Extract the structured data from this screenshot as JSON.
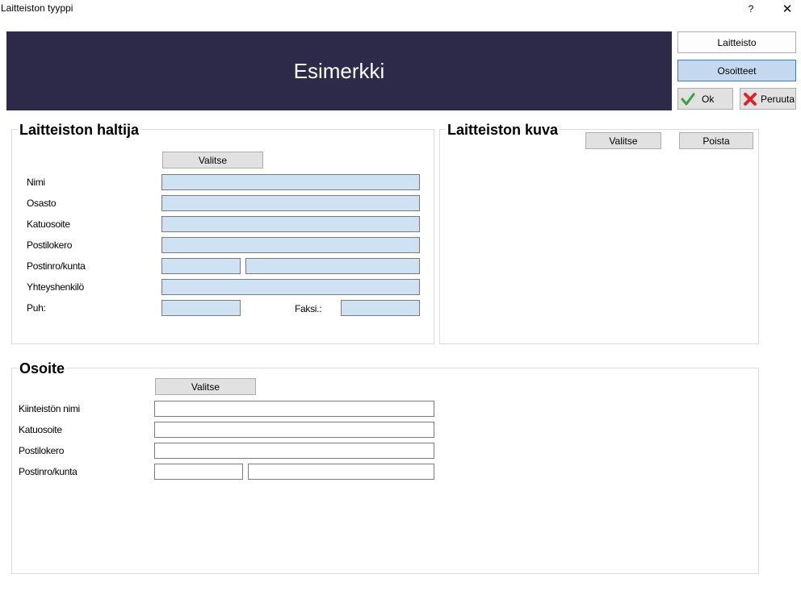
{
  "window": {
    "title": "Laitteiston tyyppi",
    "help_label": "?",
    "close_label": "✕"
  },
  "banner": {
    "text": "Esimerkki"
  },
  "side_buttons": {
    "laitteisto": "Laitteisto",
    "osoitteet": "Osoitteet",
    "ok": "Ok",
    "peruuta": "Peruuta"
  },
  "holder": {
    "title": "Laitteiston haltija",
    "select_label": "Valitse",
    "labels": {
      "nimi": "Nimi",
      "osasto": "Osasto",
      "katuosoite": "Katuosoite",
      "postilokero": "Postilokero",
      "postinro_kunta": "Postinro/kunta",
      "yhteyshenkilo": "Yhteyshenkilö",
      "puh": "Puh:",
      "faksi": "Faksi.:"
    },
    "values": {
      "nimi": "",
      "osasto": "",
      "katuosoite": "",
      "postilokero": "",
      "postinro": "",
      "kunta": "",
      "yhteyshenkilo": "",
      "puh": "",
      "faksi": ""
    }
  },
  "picture": {
    "title": "Laitteiston kuva",
    "select_label": "Valitse",
    "remove_label": "Poista"
  },
  "address": {
    "title": "Osoite",
    "select_label": "Valitse",
    "labels": {
      "kiinteisto": "Kiinteistön nimi",
      "katuosoite": "Katuosoite",
      "postilokero": "Postilokero",
      "postinro_kunta": "Postinro/kunta"
    },
    "values": {
      "kiinteisto": "",
      "katuosoite": "",
      "postilokero": "",
      "postinro": "",
      "kunta": ""
    }
  },
  "colors": {
    "banner_bg": "#2c2a48",
    "field_blue": "#cfe2f3",
    "active_button": "#c4d9f0",
    "ok_green": "#3aa33a",
    "cancel_red": "#d9262b"
  }
}
